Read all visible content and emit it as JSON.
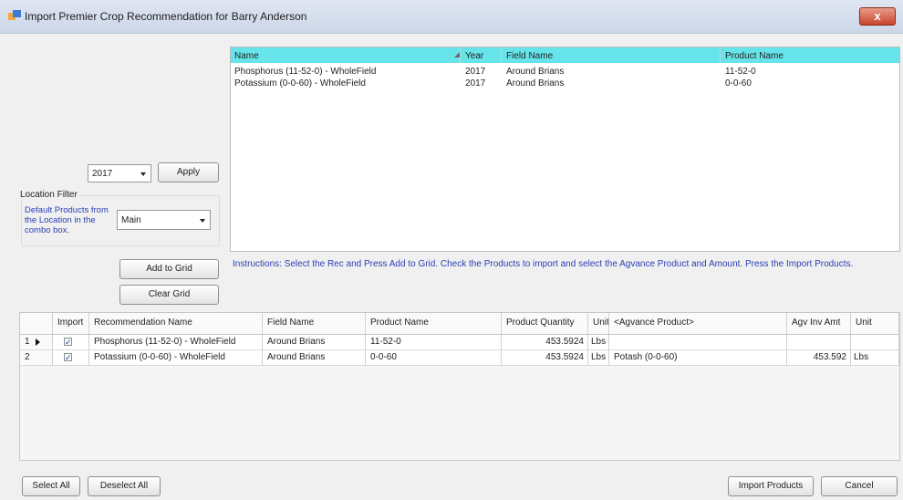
{
  "window": {
    "title": "Import Premier Crop Recommendation for Barry Anderson",
    "close_label": "x"
  },
  "year_filter": {
    "selected": "2017",
    "apply_label": "Apply"
  },
  "location_filter": {
    "legend": "Location Filter",
    "description": "Default Products from the Location in the combo box.",
    "selected": "Main"
  },
  "rec_list": {
    "columns": [
      "Name",
      "Year",
      "Field Name",
      "Product Name"
    ],
    "rows": [
      [
        "Phosphorus (11-52-0) - WholeField",
        "2017",
        "Around Brians",
        "11-52-0"
      ],
      [
        "Potassium (0-0-60) - WholeField",
        "2017",
        "Around Brians",
        "0-0-60"
      ]
    ]
  },
  "buttons": {
    "add_to_grid": "Add to Grid",
    "clear_grid": "Clear Grid",
    "select_all": "Select All",
    "deselect_all": "Deselect All",
    "import_products": "Import Products",
    "cancel": "Cancel"
  },
  "instructions": "Instructions:  Select the Rec and Press Add to Grid.  Check the Products to import and select the Agvance Product and Amount.  Press the Import Products.",
  "grid": {
    "columns": [
      "Import",
      "Recommendation Name",
      "Field Name",
      "Product Name",
      "Product Quantity",
      "Unit",
      "<Agvance Product>",
      "Agv Inv Amt",
      "Unit"
    ],
    "rows": [
      {
        "row_num": "1",
        "import": true,
        "rec": "Phosphorus (11-52-0) - WholeField",
        "field": "Around Brians",
        "product": "11-52-0",
        "qty": "453.5924",
        "unit": "Lbs",
        "agv_product": "",
        "agv_amt": "",
        "agv_unit": ""
      },
      {
        "row_num": "2",
        "import": true,
        "rec": "Potassium (0-0-60) - WholeField",
        "field": "Around Brians",
        "product": "0-0-60",
        "qty": "453.5924",
        "unit": "Lbs",
        "agv_product": "Potash (0-0-60)",
        "agv_amt": "453.592",
        "agv_unit": "Lbs"
      }
    ]
  },
  "icons": {
    "app": "app-icon",
    "dropdown": "chevron-down-icon",
    "row_pointer": "row-pointer-icon",
    "sort": "sort-icon",
    "check": "checkbox-checked-icon"
  },
  "colors": {
    "list_header": "#66e4ea",
    "instruction_text": "#2a3fb3",
    "close_button": "#c8452d"
  }
}
